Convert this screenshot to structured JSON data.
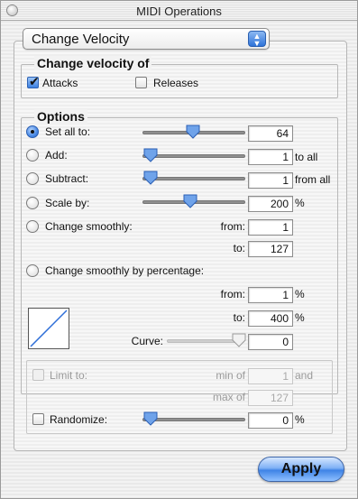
{
  "window": {
    "title": "MIDI Operations"
  },
  "operation_popup": {
    "selected": "Change Velocity"
  },
  "change_velocity_of": {
    "title": "Change velocity of",
    "attacks": {
      "label": "Attacks",
      "checked": true
    },
    "releases": {
      "label": "Releases",
      "checked": false
    }
  },
  "options": {
    "title": "Options",
    "set_all_to": {
      "label": "Set all to:",
      "value": "64",
      "selected": true
    },
    "add": {
      "label": "Add:",
      "value": "1",
      "suffix": "to all"
    },
    "subtract": {
      "label": "Subtract:",
      "value": "1",
      "suffix": "from all"
    },
    "scale_by": {
      "label": "Scale by:",
      "value": "200",
      "suffix": "%"
    },
    "change_smoothly": {
      "label": "Change smoothly:",
      "from_label": "from:",
      "from_value": "1",
      "to_label": "to:",
      "to_value": "127"
    },
    "change_smoothly_pct": {
      "label": "Change smoothly by percentage:",
      "from_label": "from:",
      "from_value": "1",
      "from_suffix": "%",
      "to_label": "to:",
      "to_value": "400",
      "to_suffix": "%",
      "curve_label": "Curve:",
      "curve_value": "0"
    },
    "limit_to": {
      "label": "Limit to:",
      "min_label": "min of",
      "min_value": "1",
      "and_label": "and",
      "max_label": "max of",
      "max_value": "127",
      "enabled": false
    },
    "randomize": {
      "label": "Randomize:",
      "value": "0",
      "suffix": "%"
    }
  },
  "apply_button": {
    "label": "Apply"
  }
}
